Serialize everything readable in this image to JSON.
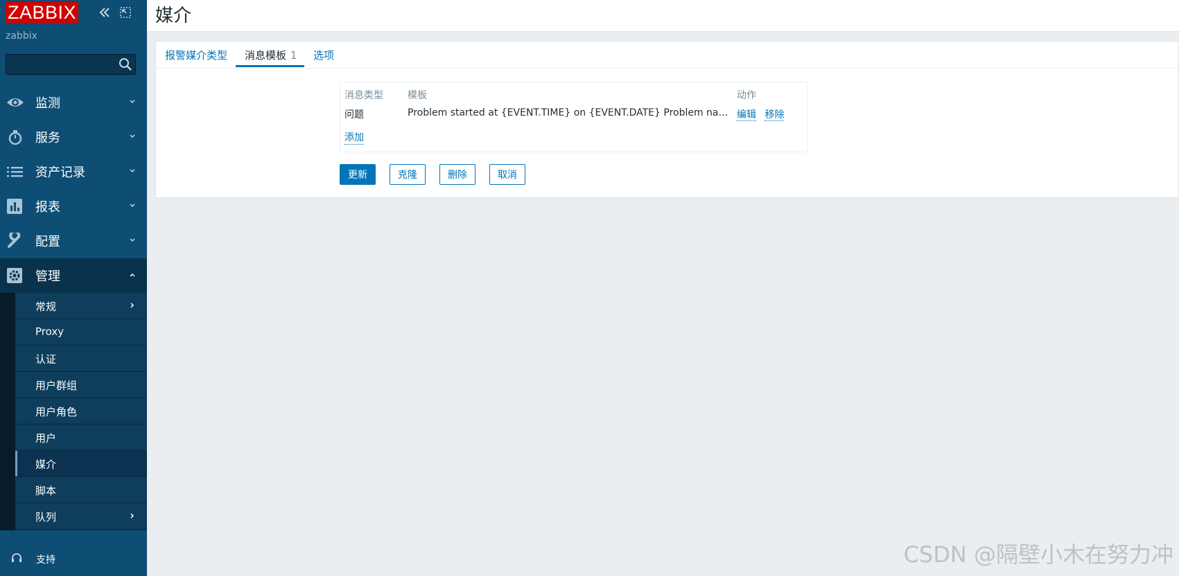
{
  "sidebar": {
    "logo": "ZABBIX",
    "server_name": "zabbix",
    "search": {
      "value": "",
      "placeholder": ""
    },
    "menu": [
      {
        "label": "监测",
        "icon": "eye-icon"
      },
      {
        "label": "服务",
        "icon": "stopwatch-icon"
      },
      {
        "label": "资产记录",
        "icon": "list-icon"
      },
      {
        "label": "报表",
        "icon": "bar-chart-icon"
      },
      {
        "label": "配置",
        "icon": "wrench-icon"
      },
      {
        "label": "管理",
        "icon": "gear-icon",
        "expanded": true
      }
    ],
    "submenu": [
      {
        "label": "常规",
        "has_children": true
      },
      {
        "label": "Proxy"
      },
      {
        "label": "认证"
      },
      {
        "label": "用户群组"
      },
      {
        "label": "用户角色"
      },
      {
        "label": "用户"
      },
      {
        "label": "媒介",
        "selected": true
      },
      {
        "label": "脚本"
      },
      {
        "label": "队列",
        "has_children": true
      }
    ],
    "support_label": "支持"
  },
  "page": {
    "title": "媒介",
    "tabs": [
      {
        "label": "报警媒介类型"
      },
      {
        "label": "消息模板",
        "count": "1",
        "active": true
      },
      {
        "label": "选项"
      }
    ],
    "table": {
      "headers": [
        "消息类型",
        "模板",
        "动作"
      ],
      "rows": [
        {
          "type": "问题",
          "template": "Problem started at {EVENT.TIME} on {EVENT.DATE} Problem name: {EVENT.NAME}",
          "actions": [
            "编辑",
            "移除"
          ]
        }
      ],
      "add_label": "添加"
    },
    "buttons": {
      "update": "更新",
      "clone": "克隆",
      "delete": "删除",
      "cancel": "取消"
    }
  },
  "watermark": "CSDN @隔壁小木在努力冲",
  "colors": {
    "sidebar_bg": "#0e4d74",
    "logo_bg": "#d40000",
    "accent": "#0275b8",
    "page_bg": "#ebeef0"
  }
}
